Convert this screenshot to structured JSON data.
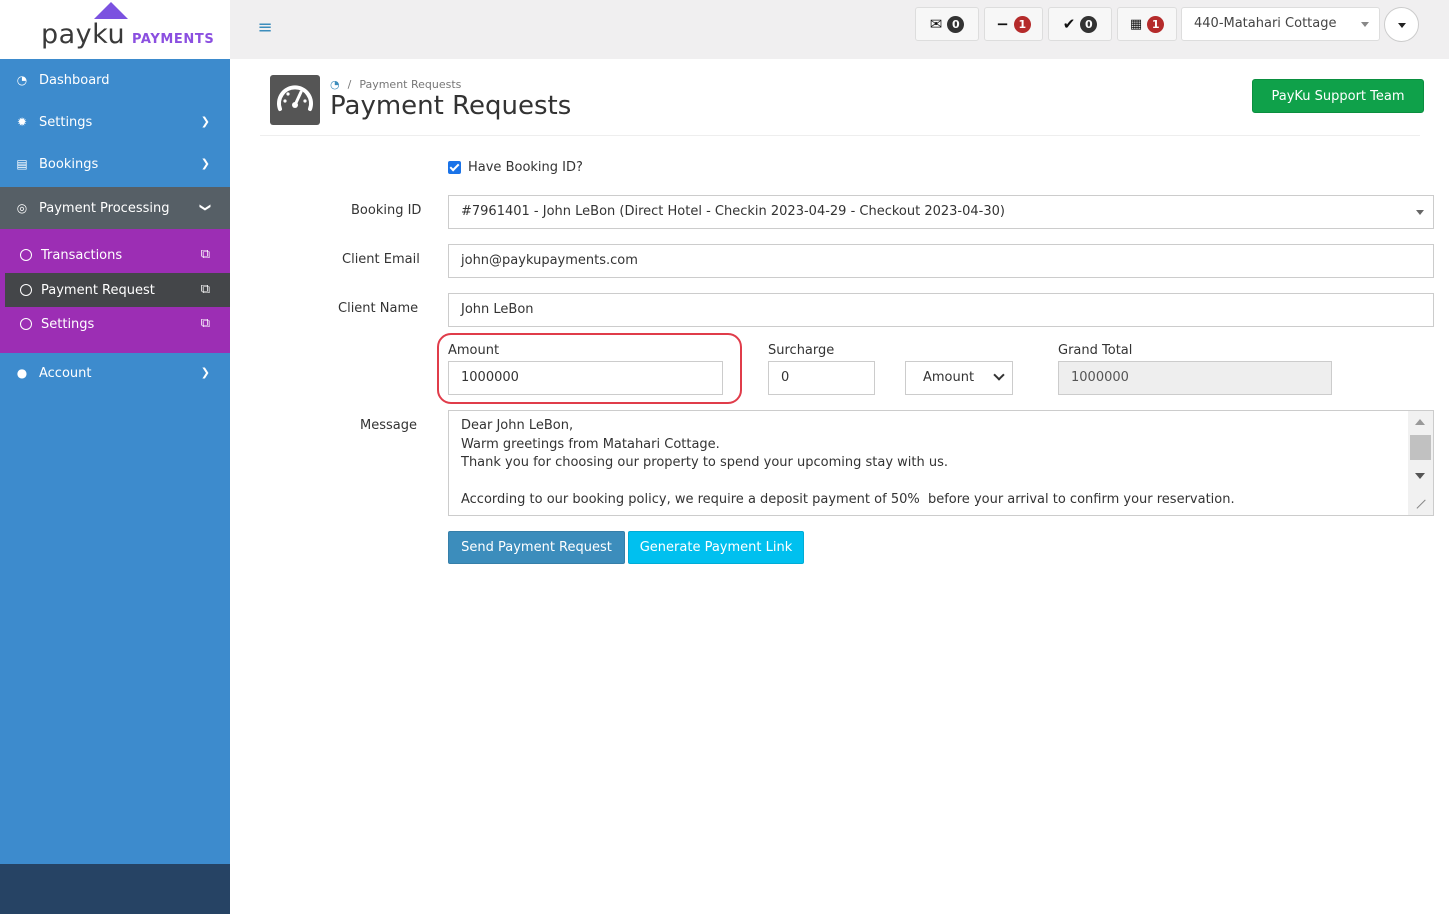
{
  "brand": {
    "name": "payku",
    "sub": "PAYMENTS"
  },
  "topbar": {
    "mail_count": "0",
    "minus_count": "1",
    "check_count": "0",
    "calendar_count": "1",
    "property": "440-Matahari Cottage"
  },
  "sidebar": {
    "items": [
      {
        "label": "Dashboard"
      },
      {
        "label": "Settings"
      },
      {
        "label": "Bookings"
      },
      {
        "label": "Payment Processing"
      },
      {
        "label": "Account"
      }
    ],
    "submenu": [
      {
        "label": "Transactions"
      },
      {
        "label": "Payment Request"
      },
      {
        "label": "Settings"
      }
    ]
  },
  "header": {
    "breadcrumb": "Payment Requests",
    "title": "Payment Requests",
    "support_button": "PayKu Support Team"
  },
  "form": {
    "have_booking_label": "Have Booking ID?",
    "booking_label": "Booking ID",
    "booking_value": "#7961401 - John LeBon (Direct Hotel - Checkin 2023-04-29 - Checkout 2023-04-30)",
    "email_label": "Client Email",
    "email_value": "john@paykupayments.com",
    "name_label": "Client Name",
    "name_value": "John LeBon",
    "amount_label": "Amount",
    "amount_value": "1000000",
    "surcharge_label": "Surcharge",
    "surcharge_value": "0",
    "surcharge_type": "Amount",
    "grand_total_label": "Grand Total",
    "grand_total_value": "1000000",
    "message_label": "Message",
    "message_lines": [
      "Dear John LeBon,",
      "Warm greetings from Matahari Cottage.",
      "Thank you for choosing our property to spend your upcoming stay with us.",
      "",
      "According to our booking policy, we require a deposit payment of 50%  before your arrival to confirm your reservation."
    ],
    "send_button": "Send Payment Request",
    "link_button": "Generate Payment Link"
  },
  "colors": {
    "sidebar": "#3d8bcd",
    "submenu": "#9c2eb4",
    "support": "#0fa14a",
    "primary": "#3c8dbc",
    "info": "#00c0ef",
    "highlight": "#e03c4a"
  }
}
